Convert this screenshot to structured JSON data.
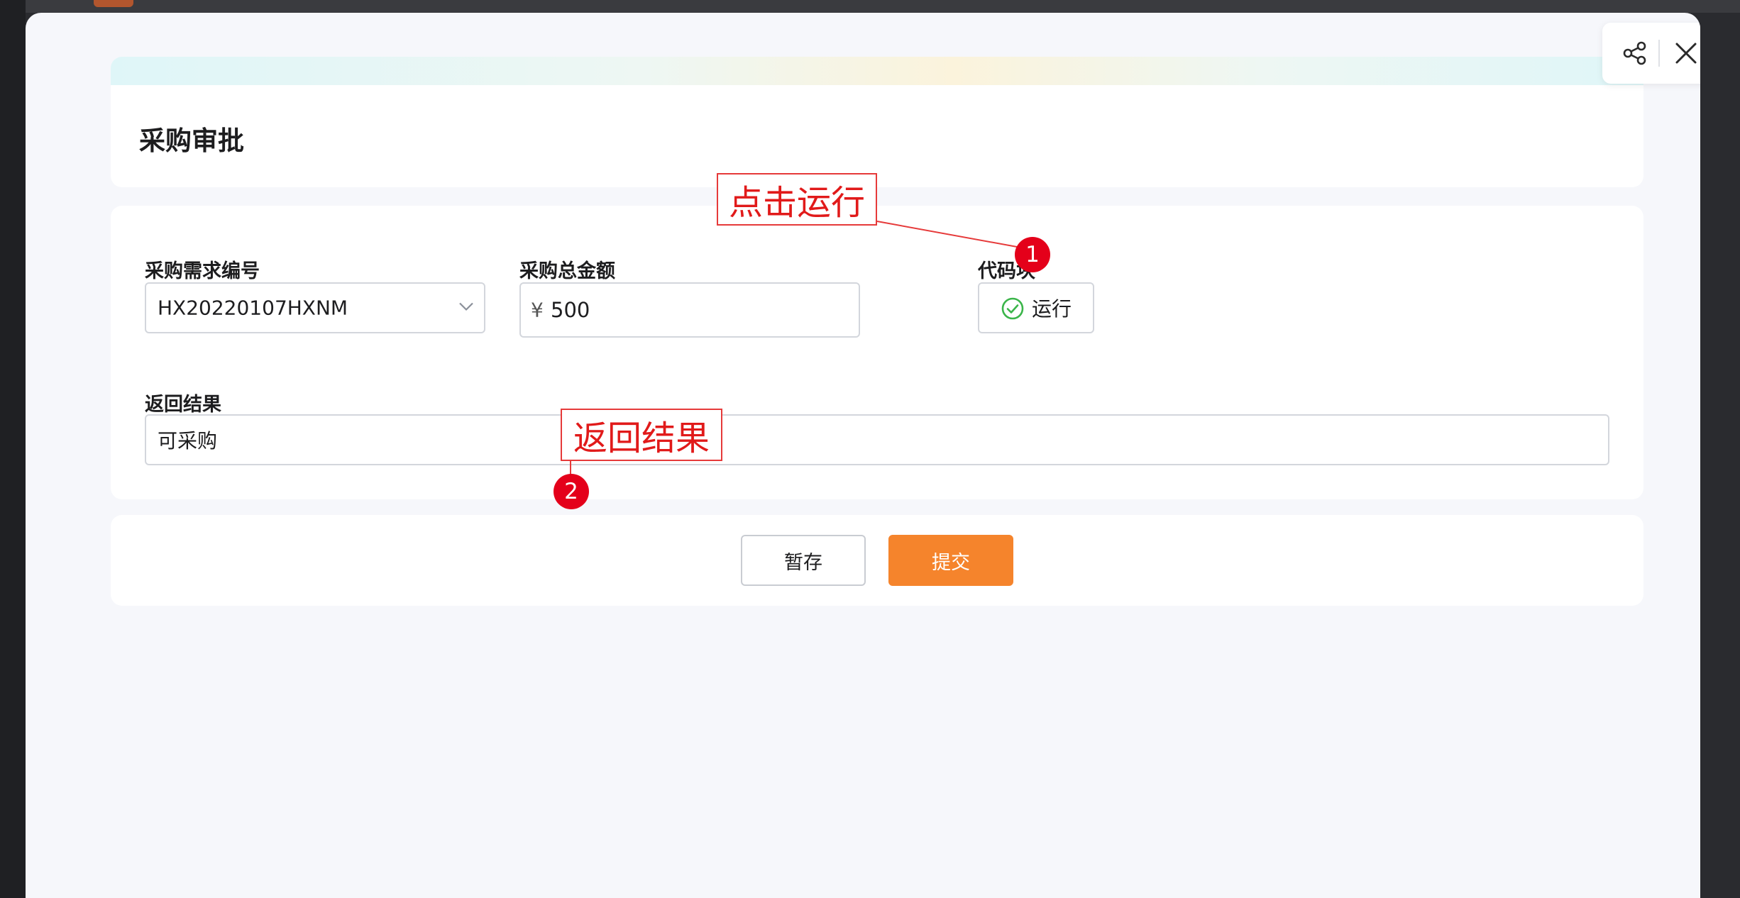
{
  "form": {
    "title": "采购审批",
    "fields": {
      "requisition_no": {
        "label": "采购需求编号",
        "value": "HX20220107HXNM"
      },
      "total_amount": {
        "label": "采购总金额",
        "currency_symbol": "¥",
        "value": "500"
      },
      "code_block": {
        "label": "代码块",
        "button_label": "运行"
      },
      "result": {
        "label": "返回结果",
        "value": "可采购"
      }
    }
  },
  "actions": {
    "save_label": "暂存",
    "submit_label": "提交"
  },
  "annotations": {
    "run": {
      "text": "点击运行",
      "number": "1"
    },
    "result": {
      "text": "返回结果",
      "number": "2"
    }
  },
  "colors": {
    "accent": "#f5842c",
    "annotation_red": "#e4001a",
    "success_green": "#3bb54a"
  },
  "icons": {
    "share": "share-icon",
    "close": "close-icon",
    "dropdown": "chevron-down-icon",
    "run_status": "check-circle-icon"
  }
}
